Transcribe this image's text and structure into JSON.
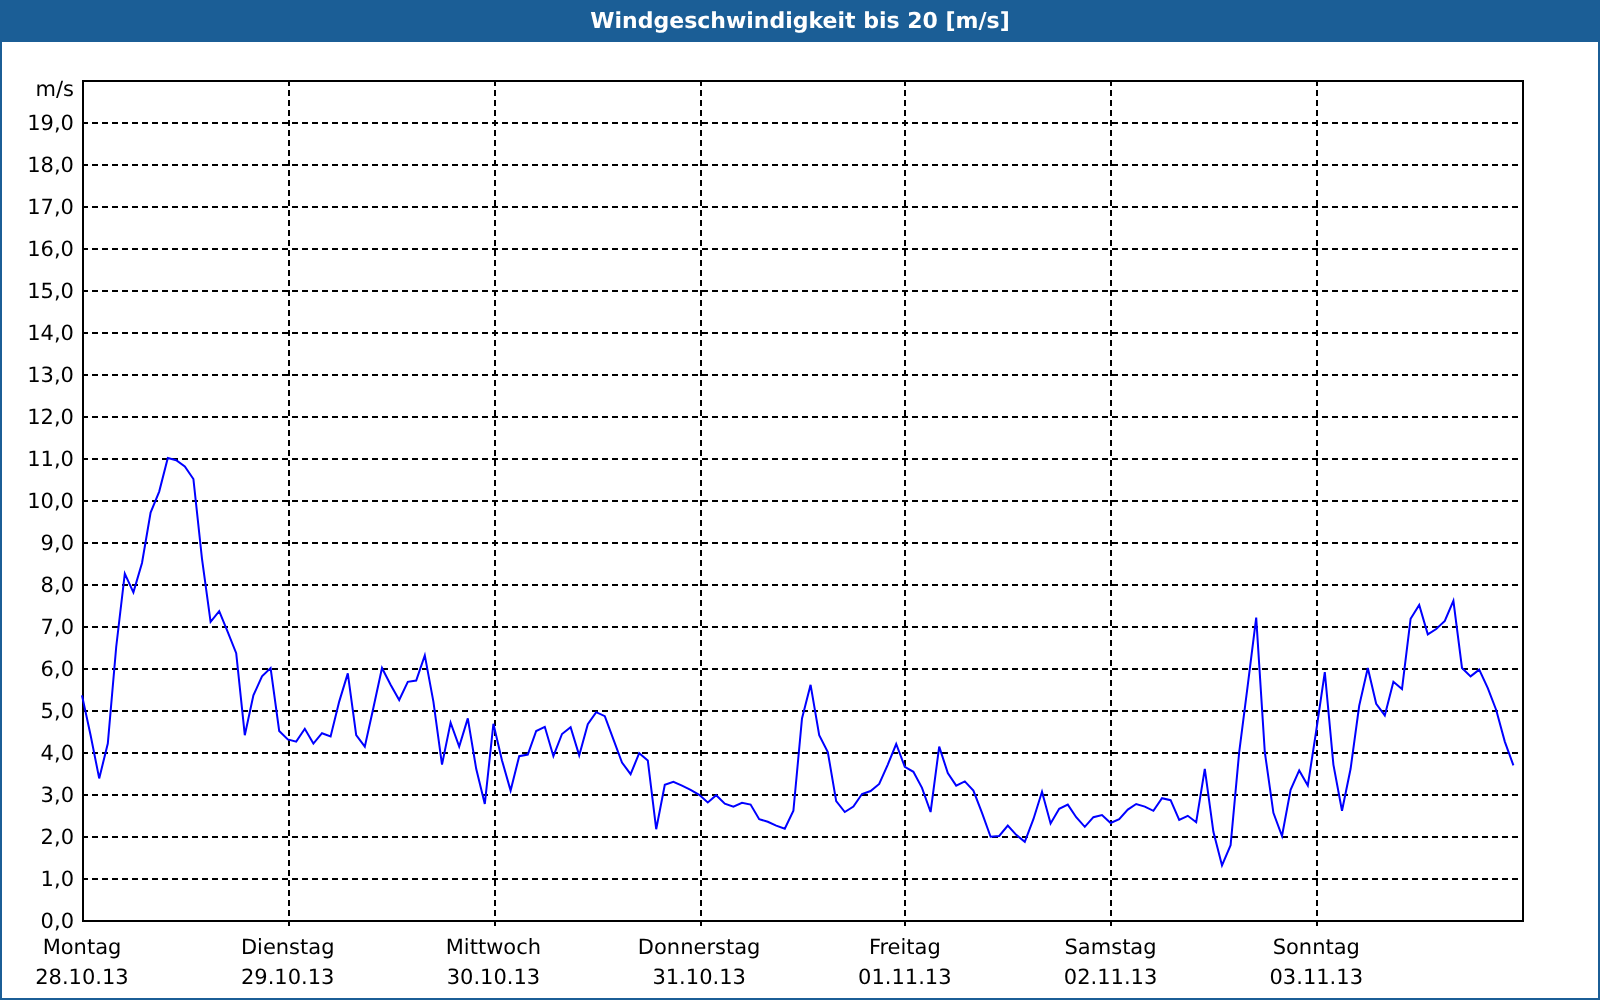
{
  "window": {
    "title": "Windgeschwindigkeit bis 20 [m/s]"
  },
  "chart": {
    "date_labels": [
      "28.10.13",
      "29.10.13",
      "30.10.13",
      "31.10.13",
      "01.11.13",
      "02.11.13",
      "03.11.13"
    ],
    "chart_data": {
      "type": "line",
      "grid": true,
      "ylabel": "m/s",
      "ylim": [
        0,
        20
      ],
      "yticks": [
        {
          "value": 0,
          "label": "0,0"
        },
        {
          "value": 1,
          "label": "1,0"
        },
        {
          "value": 2,
          "label": "2,0"
        },
        {
          "value": 3,
          "label": "3,0"
        },
        {
          "value": 4,
          "label": "4,0"
        },
        {
          "value": 5,
          "label": "5,0"
        },
        {
          "value": 6,
          "label": "6,0"
        },
        {
          "value": 7,
          "label": "7,0"
        },
        {
          "value": 8,
          "label": "8,0"
        },
        {
          "value": 9,
          "label": "9,0"
        },
        {
          "value": 10,
          "label": "10,0"
        },
        {
          "value": 11,
          "label": "11,0"
        },
        {
          "value": 12,
          "label": "12,0"
        },
        {
          "value": 13,
          "label": "13,0"
        },
        {
          "value": 14,
          "label": "14,0"
        },
        {
          "value": 15,
          "label": "15,0"
        },
        {
          "value": 16,
          "label": "16,0"
        },
        {
          "value": 17,
          "label": "17,0"
        },
        {
          "value": 18,
          "label": "18,0"
        },
        {
          "value": 19,
          "label": "19,0"
        }
      ],
      "categories": [
        "Montag",
        null,
        null,
        null,
        null,
        null,
        null,
        null,
        null,
        null,
        null,
        null,
        null,
        null,
        null,
        null,
        null,
        null,
        null,
        null,
        null,
        null,
        null,
        null,
        "Dienstag",
        null,
        null,
        null,
        null,
        null,
        null,
        null,
        null,
        null,
        null,
        null,
        null,
        null,
        null,
        null,
        null,
        null,
        null,
        null,
        null,
        null,
        null,
        null,
        "Mittwoch",
        null,
        null,
        null,
        null,
        null,
        null,
        null,
        null,
        null,
        null,
        null,
        null,
        null,
        null,
        null,
        null,
        null,
        null,
        null,
        null,
        null,
        null,
        null,
        "Donnerstag",
        null,
        null,
        null,
        null,
        null,
        null,
        null,
        null,
        null,
        null,
        null,
        null,
        null,
        null,
        null,
        null,
        null,
        null,
        null,
        null,
        null,
        null,
        null,
        "Freitag",
        null,
        null,
        null,
        null,
        null,
        null,
        null,
        null,
        null,
        null,
        null,
        null,
        null,
        null,
        null,
        null,
        null,
        null,
        null,
        null,
        null,
        null,
        null,
        "Samstag",
        null,
        null,
        null,
        null,
        null,
        null,
        null,
        null,
        null,
        null,
        null,
        null,
        null,
        null,
        null,
        null,
        null,
        null,
        null,
        null,
        null,
        null,
        null,
        "Sonntag",
        null,
        null,
        null,
        null,
        null,
        null,
        null,
        null,
        null,
        null,
        null,
        null,
        null,
        null,
        null,
        null,
        null,
        null,
        null,
        null,
        null,
        null,
        null
      ],
      "series": [
        {
          "color": "#0000ff",
          "values": [
            5.35,
            4.4,
            3.37,
            4.2,
            6.5,
            8.25,
            7.8,
            8.5,
            9.7,
            10.2,
            11.0,
            10.95,
            10.8,
            10.5,
            8.6,
            7.1,
            7.35,
            6.85,
            6.35,
            4.4,
            5.35,
            5.8,
            6.0,
            4.5,
            4.3,
            4.25,
            4.55,
            4.2,
            4.45,
            4.37,
            5.2,
            5.87,
            4.4,
            4.13,
            5.05,
            6.0,
            5.6,
            5.24,
            5.67,
            5.7,
            6.3,
            5.2,
            3.7,
            4.7,
            4.13,
            4.8,
            3.6,
            2.76,
            4.67,
            3.8,
            3.08,
            3.9,
            3.94,
            4.5,
            4.6,
            3.9,
            4.43,
            4.59,
            3.92,
            4.66,
            4.95,
            4.85,
            4.3,
            3.75,
            3.47,
            3.97,
            3.8,
            2.16,
            3.22,
            3.29,
            3.2,
            3.1,
            2.98,
            2.8,
            2.97,
            2.77,
            2.7,
            2.79,
            2.75,
            2.4,
            2.34,
            2.25,
            2.17,
            2.6,
            4.8,
            5.6,
            4.4,
            4.0,
            2.83,
            2.57,
            2.7,
            3.0,
            3.07,
            3.24,
            3.7,
            4.19,
            3.65,
            3.53,
            3.15,
            2.57,
            4.13,
            3.5,
            3.2,
            3.3,
            3.08,
            2.55,
            1.98,
            2.0,
            2.25,
            2.03,
            1.86,
            2.4,
            3.05,
            2.3,
            2.65,
            2.75,
            2.45,
            2.22,
            2.45,
            2.5,
            2.31,
            2.4,
            2.63,
            2.76,
            2.7,
            2.6,
            2.9,
            2.85,
            2.38,
            2.48,
            2.33,
            3.6,
            2.1,
            1.3,
            1.78,
            4.0,
            5.6,
            7.2,
            4.0,
            2.55,
            2.0,
            3.1,
            3.56,
            3.2,
            4.5,
            5.9,
            3.7,
            2.6,
            3.6,
            5.1,
            6.0,
            5.15,
            4.87,
            5.67,
            5.5,
            7.17,
            7.5,
            6.8,
            6.93,
            7.12,
            7.6,
            6.0,
            5.8,
            5.96,
            5.52,
            5.0,
            4.25,
            3.68
          ]
        }
      ]
    }
  }
}
